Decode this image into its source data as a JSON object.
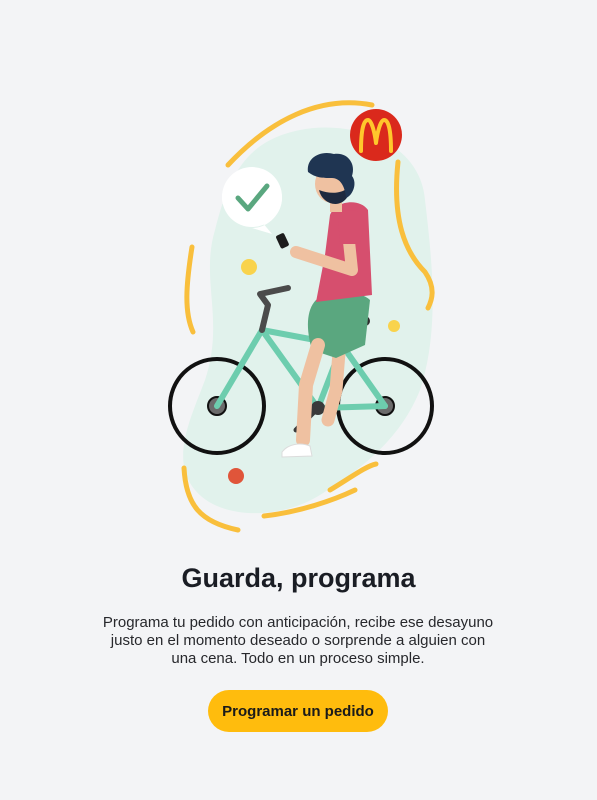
{
  "onboarding": {
    "title": "Guarda, programa",
    "description": "Programa tu pedido con anticipación, recibe ese desayuno justo en el momento deseado o sorprende a alguien con una cena. Todo en un proceso simple.",
    "cta_label": "Programar un pedido"
  },
  "illustration": {
    "brand_badge_icon": "mcdonalds-logo-icon",
    "bubble_icon": "checkmark-icon",
    "colors": {
      "accent_yellow": "#f9bf3c",
      "brand_red": "#da291c",
      "bike_frame": "#6dcdae",
      "shirt": "#d64f6e",
      "shorts": "#5aa77f",
      "blob": "#e1f2ec",
      "check": "#5aa77f"
    }
  },
  "colors": {
    "background": "#f3f4f6",
    "button": "#ffbc0d",
    "title": "#1a1d24",
    "text": "#27282c"
  }
}
